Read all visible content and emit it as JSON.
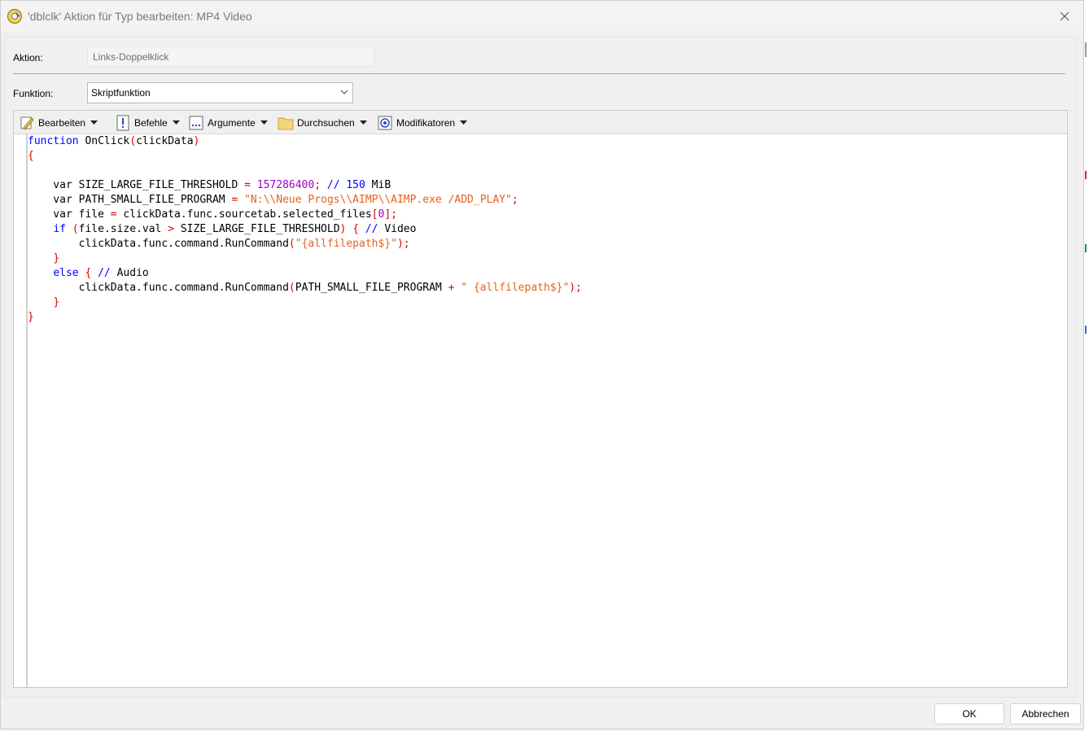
{
  "window": {
    "title": "'dblclk' Aktion für Typ bearbeiten: MP4 Video"
  },
  "form": {
    "aktion_label": "Aktion:",
    "aktion_value": "Links-Doppelklick",
    "funktion_label": "Funktion:",
    "funktion_value": "Skriptfunktion"
  },
  "toolbar": {
    "items": [
      {
        "label": "Bearbeiten",
        "icon": "edit-pencil-icon"
      },
      {
        "label": "Befehle",
        "icon": "commands-icon"
      },
      {
        "label": "Argumente",
        "icon": "arguments-icon"
      },
      {
        "label": "Durchsuchen",
        "icon": "folder-icon"
      },
      {
        "label": "Modifikatoren",
        "icon": "modifiers-icon"
      }
    ]
  },
  "code": [
    [
      [
        "kw",
        "function"
      ],
      [
        "t",
        " OnClick"
      ],
      [
        "op",
        "("
      ],
      [
        "t",
        "clickData"
      ],
      [
        "op",
        ")"
      ]
    ],
    [
      [
        "op",
        "{"
      ]
    ],
    [
      [
        "t",
        ""
      ]
    ],
    [
      [
        "t",
        "    var SIZE_LARGE_FILE_THRESHOLD "
      ],
      [
        "op",
        "="
      ],
      [
        "t",
        " "
      ],
      [
        "num",
        "157286400"
      ],
      [
        "op",
        ";"
      ],
      [
        "t",
        " "
      ],
      [
        "kw",
        "// 150"
      ],
      [
        "t",
        " MiB"
      ]
    ],
    [
      [
        "t",
        "    var PATH_SMALL_FILE_PROGRAM "
      ],
      [
        "op",
        "="
      ],
      [
        "t",
        " "
      ],
      [
        "str",
        "\"N:\\\\Neue Progs\\\\AIMP\\\\AIMP.exe /ADD_PLAY\""
      ],
      [
        "op",
        ";"
      ]
    ],
    [
      [
        "t",
        "    var file "
      ],
      [
        "op",
        "="
      ],
      [
        "t",
        " clickData.func.sourcetab.selected_files"
      ],
      [
        "op",
        "["
      ],
      [
        "num",
        "0"
      ],
      [
        "op",
        "]"
      ],
      [
        "op",
        ";"
      ]
    ],
    [
      [
        "t",
        "    "
      ],
      [
        "kw",
        "if"
      ],
      [
        "t",
        " "
      ],
      [
        "op",
        "("
      ],
      [
        "t",
        "file.size.val "
      ],
      [
        "op",
        ">"
      ],
      [
        "t",
        " SIZE_LARGE_FILE_THRESHOLD"
      ],
      [
        "op",
        ")"
      ],
      [
        "t",
        " "
      ],
      [
        "op",
        "{"
      ],
      [
        "t",
        " "
      ],
      [
        "kw",
        "//"
      ],
      [
        "t",
        " Video"
      ]
    ],
    [
      [
        "t",
        "        clickData.func.command.RunCommand"
      ],
      [
        "op",
        "("
      ],
      [
        "str",
        "\"{allfilepath$}\""
      ],
      [
        "op",
        ")"
      ],
      [
        "op",
        ";"
      ]
    ],
    [
      [
        "t",
        "    "
      ],
      [
        "op",
        "}"
      ]
    ],
    [
      [
        "t",
        "    "
      ],
      [
        "kw",
        "else"
      ],
      [
        "t",
        " "
      ],
      [
        "op",
        "{"
      ],
      [
        "t",
        " "
      ],
      [
        "kw",
        "//"
      ],
      [
        "t",
        " Audio"
      ]
    ],
    [
      [
        "t",
        "        clickData.func.command.RunCommand"
      ],
      [
        "op",
        "("
      ],
      [
        "t",
        "PATH_SMALL_FILE_PROGRAM "
      ],
      [
        "op",
        "+"
      ],
      [
        "t",
        " "
      ],
      [
        "str",
        "\" {allfilepath$}\""
      ],
      [
        "op",
        ")"
      ],
      [
        "op",
        ";"
      ]
    ],
    [
      [
        "t",
        "    "
      ],
      [
        "op",
        "}"
      ]
    ],
    [
      [
        "op",
        "}"
      ]
    ]
  ],
  "buttons": {
    "ok": "OK",
    "cancel": "Abbrechen"
  },
  "colors": {
    "keyword": "#0000ff",
    "number": "#a000c8",
    "string": "#e8601c",
    "operator": "#e00000"
  }
}
